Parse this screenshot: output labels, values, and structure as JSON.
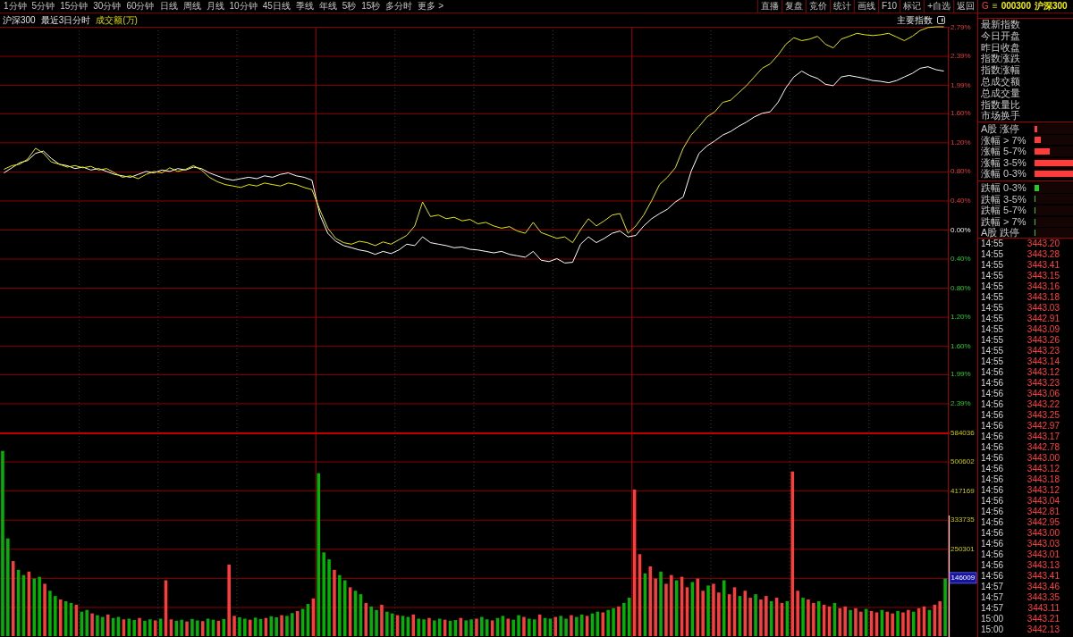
{
  "toolbar": {
    "periods": [
      "1分钟",
      "5分钟",
      "15分钟",
      "30分钟",
      "60分钟",
      "日线",
      "周线",
      "月线",
      "10分钟",
      "45日线",
      "季线",
      "年线",
      "5秒",
      "15秒",
      "多分时",
      "更多 >"
    ],
    "buttons": [
      "直播",
      "复盘",
      "竞价",
      "统计",
      "画线",
      "F10",
      "标记",
      "+自选",
      "返回"
    ]
  },
  "quote_header": {
    "mode": "G",
    "menu_symbol": "≡",
    "code": "000300",
    "name": "沪深300"
  },
  "chart_header": {
    "title": "沪深300",
    "period": "最近3日分时",
    "indicator": "成交额(万)",
    "index_button": "主要指数"
  },
  "price_chart": {
    "chart_data": {
      "type": "line",
      "grid": true,
      "ylim": [
        -2.79,
        2.79
      ],
      "yticks": [
        {
          "value": 2.79,
          "label": "2.79%"
        },
        {
          "value": 2.39,
          "label": "2.39%"
        },
        {
          "value": 1.99,
          "label": "1.99%"
        },
        {
          "value": 1.6,
          "label": "1.60%"
        },
        {
          "value": 1.2,
          "label": "1.20%"
        },
        {
          "value": 0.8,
          "label": "0.80%"
        },
        {
          "value": 0.4,
          "label": "0.40%"
        },
        {
          "value": 0,
          "label": "0.00%"
        },
        {
          "value": -0.4,
          "label": "0.40%"
        },
        {
          "value": -0.8,
          "label": "0.80%"
        },
        {
          "value": -1.2,
          "label": "1.20%"
        },
        {
          "value": -1.6,
          "label": "1.60%"
        },
        {
          "value": -1.99,
          "label": "1.99%"
        },
        {
          "value": -2.39,
          "label": "2.39%"
        }
      ],
      "series": [
        {
          "color": "#ffffff",
          "values": [
            0.78,
            0.85,
            0.92,
            0.95,
            1.05,
            1.08,
            0.98,
            0.9,
            0.88,
            0.84,
            0.86,
            0.82,
            0.84,
            0.8,
            0.76,
            0.74,
            0.72,
            0.76,
            0.8,
            0.78,
            0.82,
            0.8,
            0.84,
            0.82,
            0.86,
            0.84,
            0.78,
            0.74,
            0.7,
            0.68,
            0.7,
            0.72,
            0.7,
            0.74,
            0.72,
            0.76,
            0.78,
            0.74,
            0.72,
            0.68,
            0.2,
            -0.05,
            -0.16,
            -0.22,
            -0.25,
            -0.28,
            -0.3,
            -0.34,
            -0.3,
            -0.33,
            -0.28,
            -0.2,
            -0.22,
            -0.1,
            -0.18,
            -0.2,
            -0.22,
            -0.25,
            -0.24,
            -0.27,
            -0.28,
            -0.3,
            -0.32,
            -0.3,
            -0.34,
            -0.36,
            -0.38,
            -0.3,
            -0.42,
            -0.44,
            -0.4,
            -0.46,
            -0.45,
            -0.2,
            -0.1,
            -0.18,
            -0.12,
            -0.05,
            -0.02,
            -0.1,
            -0.08,
            0.05,
            0.15,
            0.22,
            0.28,
            0.38,
            0.45,
            0.8,
            1.05,
            1.15,
            1.22,
            1.3,
            1.35,
            1.42,
            1.48,
            1.55,
            1.6,
            1.62,
            1.75,
            1.95,
            2.1,
            2.18,
            2.12,
            2.08,
            2.0,
            1.98,
            2.1,
            2.12,
            2.1,
            2.08,
            2.05,
            2.04,
            2.02,
            2.05,
            2.1,
            2.15,
            2.22,
            2.24,
            2.2,
            2.18
          ]
        },
        {
          "color": "#e8e800",
          "values": [
            0.83,
            0.88,
            0.9,
            0.97,
            1.12,
            1.05,
            0.93,
            0.9,
            0.86,
            0.88,
            0.85,
            0.87,
            0.82,
            0.84,
            0.78,
            0.72,
            0.74,
            0.7,
            0.76,
            0.8,
            0.78,
            0.85,
            0.8,
            0.83,
            0.88,
            0.82,
            0.72,
            0.66,
            0.62,
            0.6,
            0.58,
            0.62,
            0.6,
            0.64,
            0.62,
            0.6,
            0.64,
            0.62,
            0.58,
            0.55,
            0.27,
            0.02,
            -0.12,
            -0.18,
            -0.2,
            -0.16,
            -0.18,
            -0.22,
            -0.17,
            -0.2,
            -0.14,
            -0.08,
            0.05,
            0.38,
            0.18,
            0.2,
            0.15,
            0.17,
            0.12,
            0.14,
            0.08,
            0.1,
            0.05,
            0.02,
            0.04,
            -0.02,
            -0.05,
            0.1,
            -0.04,
            -0.08,
            -0.12,
            -0.1,
            -0.18,
            0.0,
            0.15,
            0.05,
            0.12,
            0.2,
            0.22,
            -0.05,
            0.05,
            0.2,
            0.4,
            0.62,
            0.72,
            0.85,
            1.12,
            1.3,
            1.42,
            1.55,
            1.62,
            1.75,
            1.78,
            1.88,
            1.98,
            2.1,
            2.22,
            2.28,
            2.4,
            2.55,
            2.64,
            2.6,
            2.62,
            2.66,
            2.55,
            2.5,
            2.62,
            2.66,
            2.7,
            2.68,
            2.67,
            2.68,
            2.7,
            2.65,
            2.6,
            2.66,
            2.74,
            2.78,
            2.79,
            2.79
          ]
        }
      ]
    }
  },
  "volume_chart": {
    "chart_data": {
      "type": "bar",
      "grid": true,
      "ylim": [
        0,
        584036
      ],
      "yticks": [
        584036,
        500602,
        417169,
        333735,
        250301
      ],
      "series": [
        {
          "color": "#ff3c3c",
          "values": [
            0,
            0,
            215000,
            0,
            0,
            185000,
            0,
            0,
            150000,
            0,
            0,
            105000,
            0,
            0,
            90000,
            0,
            0,
            65000,
            0,
            0,
            62000,
            0,
            0,
            48000,
            0,
            0,
            52000,
            0,
            0,
            45000,
            0,
            160000,
            48000,
            0,
            0,
            42000,
            0,
            0,
            43000,
            0,
            0,
            44000,
            0,
            205000,
            58000,
            0,
            0,
            47000,
            0,
            0,
            52000,
            0,
            0,
            60000,
            0,
            0,
            72000,
            0,
            0,
            108000,
            0,
            0,
            0,
            190000,
            0,
            0,
            140000,
            0,
            0,
            95000,
            0,
            0,
            90000,
            0,
            0,
            60000,
            0,
            0,
            62000,
            0,
            0,
            52000,
            0,
            0,
            47000,
            0,
            0,
            52000,
            0,
            0,
            50000,
            0,
            0,
            45000,
            0,
            0,
            50000,
            0,
            0,
            55000,
            0,
            0,
            62000,
            0,
            0,
            55000,
            0,
            0,
            60000,
            0,
            0,
            58000,
            0,
            0,
            68000,
            0,
            0,
            85000,
            0,
            0,
            420000,
            235000,
            0,
            200000,
            165000,
            0,
            150000,
            175000,
            0,
            170000,
            140000,
            0,
            165000,
            130000,
            0,
            150000,
            125000,
            0,
            120000,
            140000,
            0,
            130000,
            110000,
            0,
            105000,
            115000,
            0,
            110000,
            95000,
            0,
            472000,
            130000,
            0,
            105000,
            95000,
            0,
            90000,
            85000,
            0,
            80000,
            85000,
            0,
            80000,
            70000,
            0,
            72000,
            68000,
            0,
            70000,
            65000,
            0,
            68000,
            75000,
            0,
            80000,
            85000,
            0,
            90000,
            100000,
            0
          ]
        },
        {
          "color": "#00b400",
          "values": [
            531000,
            280000,
            0,
            190000,
            175000,
            0,
            165000,
            170000,
            0,
            130000,
            115000,
            0,
            100000,
            95000,
            0,
            70000,
            75000,
            0,
            60000,
            55000,
            0,
            52000,
            55000,
            0,
            50000,
            46000,
            0,
            44000,
            48000,
            0,
            50000,
            0,
            0,
            44000,
            47000,
            0,
            49000,
            45000,
            0,
            50000,
            47000,
            0,
            49000,
            0,
            0,
            54000,
            50000,
            0,
            53000,
            49000,
            0,
            57000,
            54000,
            0,
            58000,
            66000,
            0,
            78000,
            92000,
            0,
            467000,
            240000,
            220000,
            0,
            175000,
            160000,
            0,
            130000,
            120000,
            0,
            85000,
            75000,
            0,
            70000,
            65000,
            0,
            58000,
            55000,
            0,
            50000,
            48000,
            0,
            45000,
            50000,
            0,
            44000,
            46000,
            0,
            45000,
            48000,
            0,
            55000,
            48000,
            0,
            52000,
            58000,
            0,
            47000,
            60000,
            0,
            50000,
            48000,
            0,
            52000,
            50000,
            0,
            58000,
            50000,
            0,
            55000,
            62000,
            0,
            65000,
            70000,
            0,
            75000,
            80000,
            0,
            95000,
            110000,
            0,
            0,
            180000,
            0,
            0,
            185000,
            0,
            0,
            160000,
            0,
            0,
            155000,
            0,
            0,
            145000,
            0,
            0,
            160000,
            0,
            0,
            115000,
            0,
            0,
            120000,
            0,
            0,
            100000,
            0,
            0,
            100000,
            0,
            0,
            110000,
            0,
            0,
            100000,
            0,
            0,
            95000,
            0,
            0,
            75000,
            0,
            0,
            78000,
            0,
            0,
            75000,
            0,
            0,
            72000,
            0,
            0,
            70000,
            0,
            0,
            75000,
            0,
            0,
            165000
          ]
        }
      ]
    },
    "readout": "146009"
  },
  "quote_fields": [
    "最新指数",
    "今日开盘",
    "昨日收盘",
    "指数涨跌",
    "指数涨幅",
    "总成交额",
    "总成交量",
    "指数量比",
    "市场换手"
  ],
  "breadth": [
    {
      "label": "A股 涨停",
      "kind": "up",
      "level": 0.07
    },
    {
      "label": "涨幅 > 7%",
      "kind": "up",
      "level": 0.16
    },
    {
      "label": "涨幅 5-7%",
      "kind": "up",
      "level": 0.4
    },
    {
      "label": "涨幅 3-5%",
      "kind": "up",
      "level": 1
    },
    {
      "label": "涨幅 0-3%",
      "kind": "up",
      "level": 1
    },
    {
      "label": "跌幅 0-3%",
      "kind": "down",
      "level": 0.12
    },
    {
      "label": "跌幅 3-5%",
      "kind": "down",
      "level": 0.02
    },
    {
      "label": "跌幅 5-7%",
      "kind": "down",
      "level": 0.02
    },
    {
      "label": "跌幅 > 7%",
      "kind": "down",
      "level": 0.02
    },
    {
      "label": "A股 跌停",
      "kind": "down",
      "level": 0.02
    }
  ],
  "ticks": [
    {
      "time": "14:55",
      "price": "3443.20"
    },
    {
      "time": "14:55",
      "price": "3443.28"
    },
    {
      "time": "14:55",
      "price": "3443.41"
    },
    {
      "time": "14:55",
      "price": "3443.15"
    },
    {
      "time": "14:55",
      "price": "3443.16"
    },
    {
      "time": "14:55",
      "price": "3443.18"
    },
    {
      "time": "14:55",
      "price": "3443.03"
    },
    {
      "time": "14:55",
      "price": "3442.91"
    },
    {
      "time": "14:55",
      "price": "3443.09"
    },
    {
      "time": "14:55",
      "price": "3443.26"
    },
    {
      "time": "14:55",
      "price": "3443.23"
    },
    {
      "time": "14:55",
      "price": "3443.14"
    },
    {
      "time": "14:56",
      "price": "3443.12"
    },
    {
      "time": "14:56",
      "price": "3443.23"
    },
    {
      "time": "14:56",
      "price": "3443.06"
    },
    {
      "time": "14:56",
      "price": "3443.22"
    },
    {
      "time": "14:56",
      "price": "3443.25"
    },
    {
      "time": "14:56",
      "price": "3442.97"
    },
    {
      "time": "14:56",
      "price": "3443.17"
    },
    {
      "time": "14:56",
      "price": "3442.78"
    },
    {
      "time": "14:56",
      "price": "3443.00"
    },
    {
      "time": "14:56",
      "price": "3443.12"
    },
    {
      "time": "14:56",
      "price": "3443.18"
    },
    {
      "time": "14:56",
      "price": "3443.12"
    },
    {
      "time": "14:56",
      "price": "3443.04"
    },
    {
      "time": "14:56",
      "price": "3442.81"
    },
    {
      "time": "14:56",
      "price": "3442.95"
    },
    {
      "time": "14:56",
      "price": "3443.00"
    },
    {
      "time": "14:56",
      "price": "3443.03"
    },
    {
      "time": "14:56",
      "price": "3443.01"
    },
    {
      "time": "14:56",
      "price": "3443.13"
    },
    {
      "time": "14:56",
      "price": "3443.41"
    },
    {
      "time": "14:57",
      "price": "3443.46"
    },
    {
      "time": "14:57",
      "price": "3443.35"
    },
    {
      "time": "14:57",
      "price": "3443.11"
    },
    {
      "time": "15:00",
      "price": "3443.21"
    },
    {
      "time": "15:00",
      "price": "3442.13"
    }
  ]
}
